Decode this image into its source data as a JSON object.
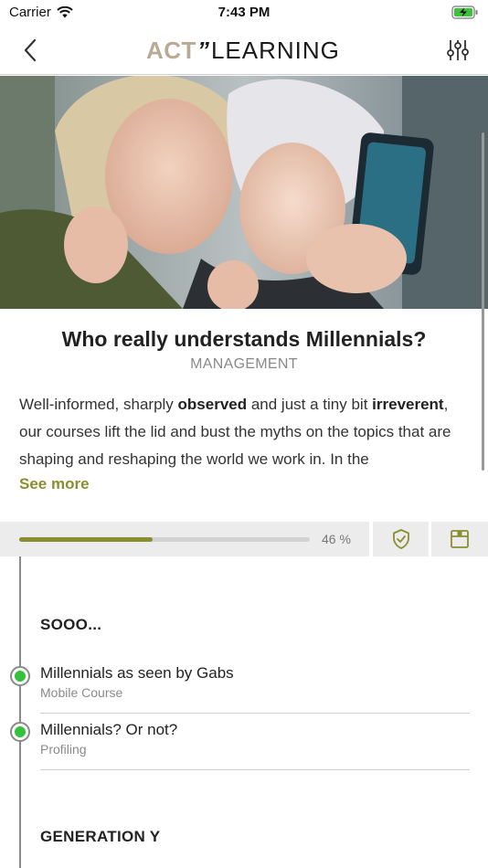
{
  "status_bar": {
    "carrier": "Carrier",
    "time": "7:43 PM"
  },
  "nav": {
    "logo_act": "ACT",
    "logo_quote": "”",
    "logo_learning": "LEARNING"
  },
  "course": {
    "title": "Who really understands Millennials?",
    "category": "MANAGEMENT",
    "description_parts": {
      "p1": "Well-informed, sharply ",
      "b1": "observed",
      "p2": " and just a tiny bit ",
      "b2": "irreverent",
      "p3": ", our courses lift the lid and bust the myths on the topics that are shaping and reshaping the world we work in. In the"
    },
    "see_more": "See more",
    "progress_percent": 46,
    "progress_label": "46 %"
  },
  "sections": [
    {
      "header": "SOOO...",
      "lessons": [
        {
          "title": "Millennials as seen by Gabs",
          "subtitle": "Mobile Course",
          "status": "completed"
        },
        {
          "title": "Millennials? Or not?",
          "subtitle": "Profiling",
          "status": "completed"
        }
      ]
    },
    {
      "header": "GENERATION Y",
      "lessons": []
    }
  ],
  "colors": {
    "accent": "#8a8f2e",
    "completed": "#33c23a",
    "logo_act": "#b7ab96"
  },
  "icons": {
    "back": "chevron-left-icon",
    "filter": "sliders-icon",
    "badge": "shield-check-icon",
    "box": "package-icon"
  }
}
